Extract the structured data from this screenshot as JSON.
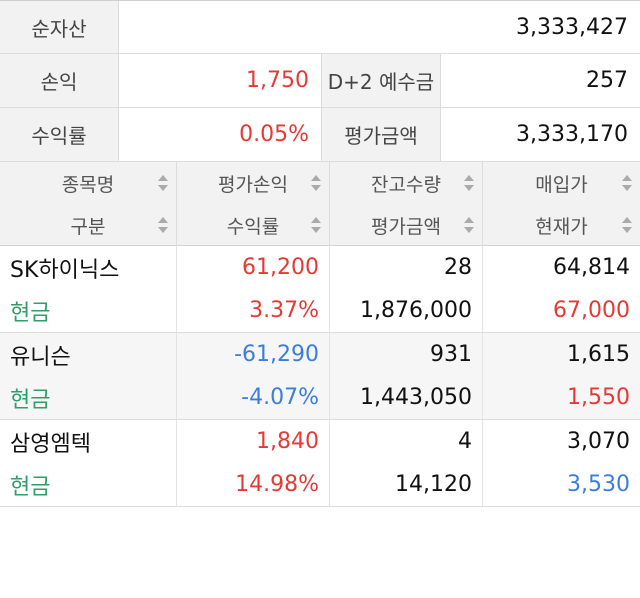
{
  "summary": {
    "net_assets_label": "순자산",
    "net_assets_value": "3,333,427",
    "pnl_label": "손익",
    "pnl_value": "1,750",
    "deposit_label": "D+2 예수금",
    "deposit_value": "257",
    "return_label": "수익률",
    "return_value": "0.05%",
    "eval_label": "평가금액",
    "eval_value": "3,333,170"
  },
  "headers": {
    "row1": [
      "종목명",
      "평가손익",
      "잔고수량",
      "매입가"
    ],
    "row2": [
      "구분",
      "수익률",
      "평가금액",
      "현재가"
    ]
  },
  "holdings": [
    {
      "name": "SK하이닉스",
      "type": "현금",
      "eval_pnl": "61,200",
      "return_rate": "3.37%",
      "quantity": "28",
      "eval_amount": "1,876,000",
      "buy_price": "64,814",
      "current_price": "67,000"
    },
    {
      "name": "유니슨",
      "type": "현금",
      "eval_pnl": "-61,290",
      "return_rate": "-4.07%",
      "quantity": "931",
      "eval_amount": "1,443,050",
      "buy_price": "1,615",
      "current_price": "1,550"
    },
    {
      "name": "삼영엠텍",
      "type": "현금",
      "eval_pnl": "1,840",
      "return_rate": "14.98%",
      "quantity": "4",
      "eval_amount": "14,120",
      "buy_price": "3,070",
      "current_price": "3,530"
    }
  ],
  "colors": {
    "up": "#e53935",
    "down": "#3b7ddd",
    "cash": "#2e9e6a"
  }
}
